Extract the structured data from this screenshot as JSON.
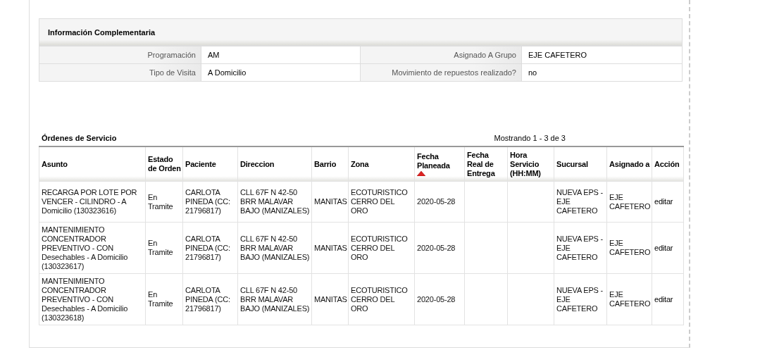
{
  "info": {
    "title": "Información Complementaria",
    "rows": [
      [
        {
          "label": "Programación",
          "value": "AM"
        },
        {
          "label": "Asignado A Grupo",
          "value": "EJE CAFETERO"
        }
      ],
      [
        {
          "label": "Tipo de Visita",
          "value": "A Domicilio"
        },
        {
          "label": "Movimiento de repuestos realizado?",
          "value": "no"
        }
      ]
    ]
  },
  "orders": {
    "title": "Órdenes de Servicio",
    "pager": "Mostrando 1 - 3 de 3",
    "columns": [
      {
        "label": "Asunto",
        "sorted": false
      },
      {
        "label": "Estado de Orden",
        "sorted": false
      },
      {
        "label": "Paciente",
        "sorted": false
      },
      {
        "label": "Direccion",
        "sorted": false
      },
      {
        "label": "Barrio",
        "sorted": false
      },
      {
        "label": "Zona",
        "sorted": false
      },
      {
        "label": "Fecha Planeada",
        "sorted": true
      },
      {
        "label": "Fecha Real de Entrega",
        "sorted": false
      },
      {
        "label": "Hora Servicio (HH:MM)",
        "sorted": false
      },
      {
        "label": "Sucursal",
        "sorted": false
      },
      {
        "label": "Asignado a",
        "sorted": false
      },
      {
        "label": "Acción",
        "sorted": false
      }
    ],
    "rows": [
      {
        "cells": [
          "RECARGA POR LOTE POR VENCER - CILINDRO - A Domicilio (130323616)",
          "En Tramite",
          "CARLOTA PINEDA (CC: 21796817)",
          "CLL 67F N 42-50 BRR MALAVAR BAJO (MANIZALES)",
          "MANITAS",
          "ECOTURISTICO CERRO DEL ORO",
          "2020-05-28",
          "",
          "",
          "NUEVA EPS - EJE CAFETERO",
          "EJE CAFETERO"
        ],
        "action": "editar"
      },
      {
        "cells": [
          "MANTENIMIENTO CONCENTRADOR PREVENTIVO - CON Desechables - A Domicilio (130323617)",
          "En Tramite",
          "CARLOTA PINEDA (CC: 21796817)",
          "CLL 67F N 42-50 BRR MALAVAR BAJO (MANIZALES)",
          "MANITAS",
          "ECOTURISTICO CERRO DEL ORO",
          "2020-05-28",
          "",
          "",
          "NUEVA EPS - EJE CAFETERO",
          "EJE CAFETERO"
        ],
        "action": "editar"
      },
      {
        "cells": [
          "MANTENIMIENTO CONCENTRADOR PREVENTIVO - CON Desechables - A Domicilio (130323618)",
          "En Tramite",
          "CARLOTA PINEDA (CC: 21796817)",
          "CLL 67F N 42-50 BRR MALAVAR BAJO (MANIZALES)",
          "MANITAS",
          "ECOTURISTICO CERRO DEL ORO",
          "2020-05-28",
          "",
          "",
          "NUEVA EPS - EJE CAFETERO",
          "EJE CAFETERO"
        ],
        "action": "editar"
      }
    ]
  }
}
